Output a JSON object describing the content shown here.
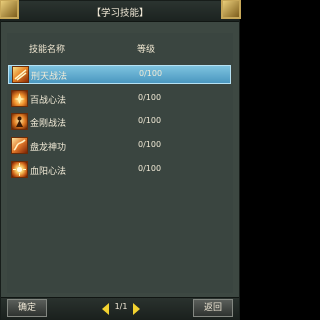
{
  "window": {
    "title": "【学习技能】"
  },
  "table": {
    "col_name": "技能名称",
    "col_level": "等级"
  },
  "skills": [
    {
      "name": "刑天战法",
      "level": "0/100",
      "selected": true,
      "icon": "skill-fire-warrior-icon"
    },
    {
      "name": "百战心法",
      "level": "0/100",
      "selected": false,
      "icon": "skill-battle-spirit-icon"
    },
    {
      "name": "金刚战法",
      "level": "0/100",
      "selected": false,
      "icon": "skill-vajra-icon"
    },
    {
      "name": "盘龙神功",
      "level": "0/100",
      "selected": false,
      "icon": "skill-coiled-dragon-icon"
    },
    {
      "name": "血阳心法",
      "level": "0/100",
      "selected": false,
      "icon": "skill-blood-sun-icon"
    }
  ],
  "footer": {
    "confirm_label": "确定",
    "back_label": "返回",
    "page": "1/1"
  },
  "colors": {
    "panel": "#3d4842",
    "selection": "#6bb5d8",
    "gold": "#d4b15a",
    "text": "#f3ecd8"
  }
}
